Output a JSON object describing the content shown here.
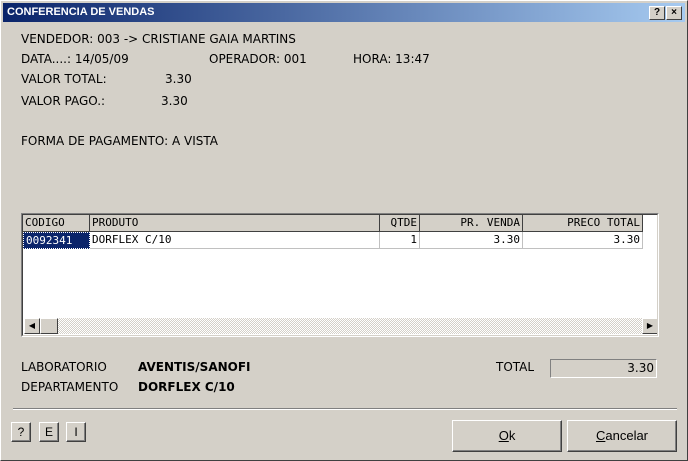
{
  "window": {
    "title": "CONFERENCIA DE VENDAS",
    "help_btn": "?",
    "close_btn": "×"
  },
  "header": {
    "vendedor": "VENDEDOR: 003 -> CRISTIANE GAIA MARTINS",
    "data": "DATA....: 14/05/09",
    "operador": "OPERADOR: 001",
    "hora": "HORA: 13:47",
    "valor_total_label": "VALOR TOTAL:",
    "valor_total": "3.30",
    "valor_pago_label": "VALOR PAGO.:",
    "valor_pago": "3.30",
    "forma_pagamento": "FORMA DE PAGAMENTO: A VISTA"
  },
  "grid": {
    "columns": [
      "CODIGO",
      "PRODUTO",
      "QTDE",
      "PR. VENDA",
      "PRECO TOTAL"
    ],
    "rows": [
      {
        "codigo": "0092341",
        "produto": "DORFLEX C/10",
        "qtde": "1",
        "pr_venda": "3.30",
        "preco_total": "3.30"
      }
    ],
    "scroll_left": "◀",
    "scroll_right": "▶"
  },
  "footer": {
    "laboratorio_label": "LABORATORIO",
    "laboratorio_value": "AVENTIS/SANOFI",
    "departamento_label": "DEPARTAMENTO",
    "departamento_value": "DORFLEX C/10",
    "total_label": "TOTAL",
    "total_value": "3.30"
  },
  "buttons": {
    "help": "?",
    "e": "E",
    "i": "I",
    "ok_first": "O",
    "ok_rest": "k",
    "cancel_first": "C",
    "cancel_rest": "ancelar"
  }
}
